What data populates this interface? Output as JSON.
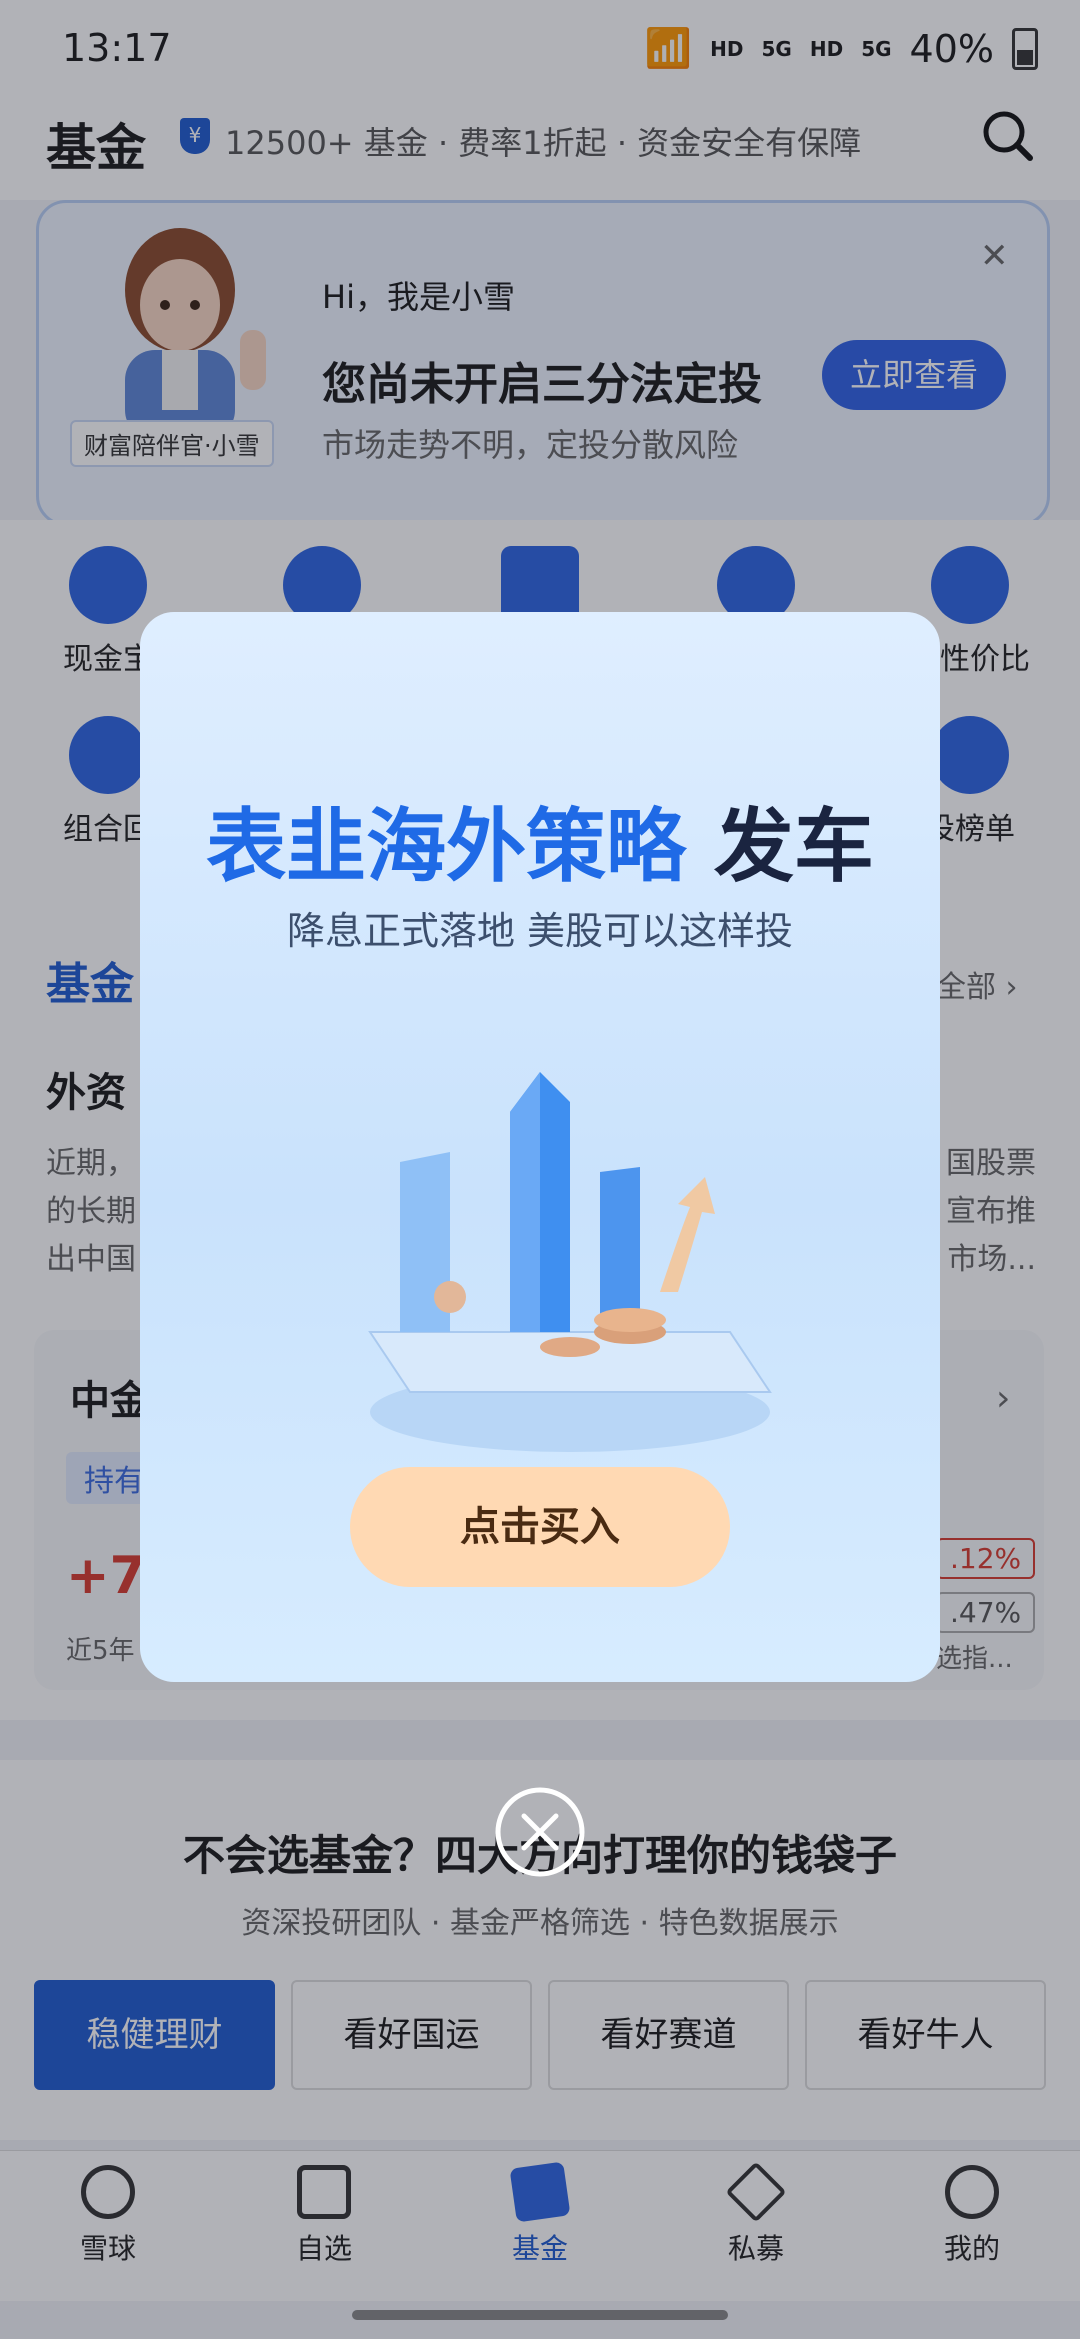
{
  "status_bar": {
    "time": "13:17",
    "network_label_1": "HD",
    "network_label_2": "5G",
    "network_label_3": "HD",
    "network_label_4": "5G",
    "battery": "40%"
  },
  "header": {
    "title": "基金",
    "shield_glyph": "¥",
    "subtitle": "12500+ 基金 · 费率1折起 · 资金安全有保障"
  },
  "banner": {
    "avatar_tag": "财富陪伴官·小雪",
    "greeting": "Hi，我是小雪",
    "title": "您尚未开启三分法定投",
    "desc": "市场走势不明，定投分散风险",
    "button": "立即查看",
    "close": "✕"
  },
  "quick_grid": {
    "row1": [
      "现金宝",
      "",
      "",
      "",
      "债性价比"
    ],
    "row2": [
      "组合回",
      "",
      "",
      "",
      "投榜单"
    ]
  },
  "section": {
    "title": "基金",
    "all_link": "全部 ›",
    "headline": "外资",
    "text_left": [
      "近期，",
      "的长期",
      "出中国"
    ],
    "text_right": [
      "国股票",
      "宣布推",
      "市场..."
    ],
    "card": {
      "name": "中金",
      "badge": "持有",
      "rate": "+7.",
      "rate_label": "近5年",
      "tag1": ".12%",
      "tag2": ".47%",
      "note": "选指...",
      "chevron": "›"
    }
  },
  "promo": {
    "title": "不会选基金？四大方向打理你的钱袋子",
    "subtitle": "资深投研团队 · 基金严格筛选 · 特色数据展示",
    "tabs": [
      "稳健理财",
      "看好国运",
      "看好赛道",
      "看好牛人"
    ]
  },
  "tabbar": [
    "雪球",
    "自选",
    "基金",
    "私募",
    "我的"
  ],
  "modal": {
    "title_blue": "表韭海外策略 ",
    "title_dark": "发车",
    "subtitle": "降息正式落地 美股可以这样投",
    "button": "点击买入"
  },
  "colors": {
    "accent": "#1f5bd1",
    "modal_button": "#ffd9b3",
    "red": "#d83a2e"
  }
}
